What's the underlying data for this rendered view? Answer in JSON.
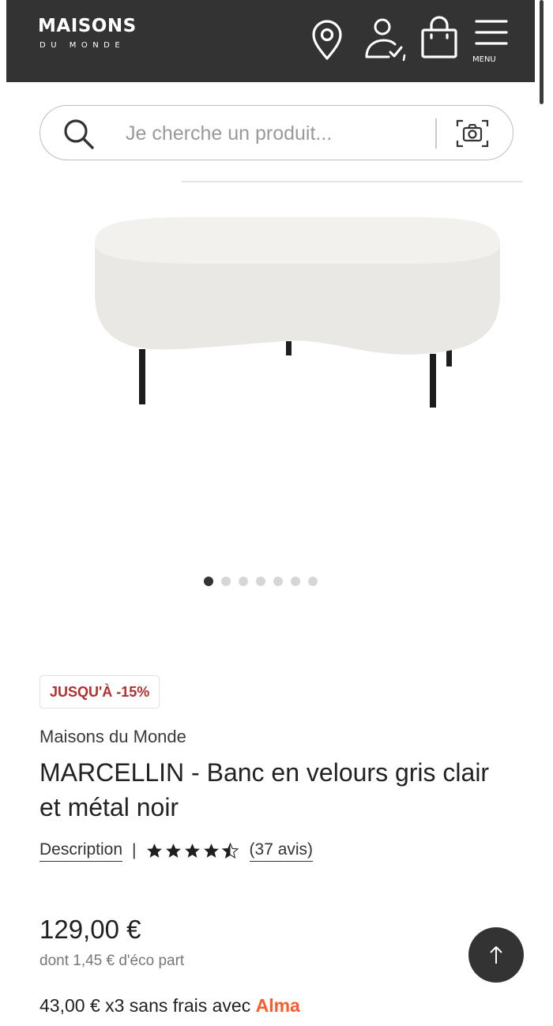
{
  "header": {
    "logo_main": "MAISONS",
    "logo_sub": "DU MONDE",
    "menu_label": "MENU",
    "icons": [
      "location-pin-icon",
      "account-icon",
      "shopping-bag-icon",
      "hamburger-menu-icon"
    ],
    "background_color": "#333333"
  },
  "search": {
    "placeholder": "Je cherche un produit...",
    "icons": [
      "search-icon",
      "camera-search-icon"
    ]
  },
  "gallery": {
    "slide_count": 7,
    "active_slide": 1
  },
  "product": {
    "badge": "JUSQU'À -15%",
    "brand": "Maisons du Monde",
    "title": "MARCELLIN - Banc en velours gris clair et métal noir",
    "description_link": "Description",
    "separator": "|",
    "rating": 4.5,
    "reviews": "(37 avis)",
    "price": "129,00 €",
    "eco_part": "dont 1,45 € d'éco part",
    "installments": "43,00 € x3 sans frais avec",
    "installments_brand": "Alma"
  },
  "colors": {
    "badge_text": "#b52d2d",
    "alma": "#ff5a2b"
  }
}
